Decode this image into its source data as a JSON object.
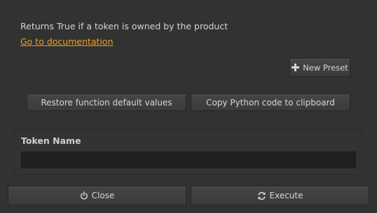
{
  "description": "Returns True if a token is owned by the product",
  "doc_link": "Go to documentation",
  "toolbar": {
    "new_preset_label": "New Preset",
    "new_preset_icon": "plus-icon"
  },
  "actions": {
    "restore_label": "Restore function default values",
    "copy_label": "Copy Python code to clipboard"
  },
  "parameters": [
    {
      "label": "Token Name",
      "value": ""
    }
  ],
  "footer": {
    "close_label": "Close",
    "close_icon": "power-icon",
    "execute_label": "Execute",
    "execute_icon": "refresh-icon"
  },
  "colors": {
    "background": "#323232",
    "link": "#f0a020",
    "input_bg": "#202020"
  }
}
